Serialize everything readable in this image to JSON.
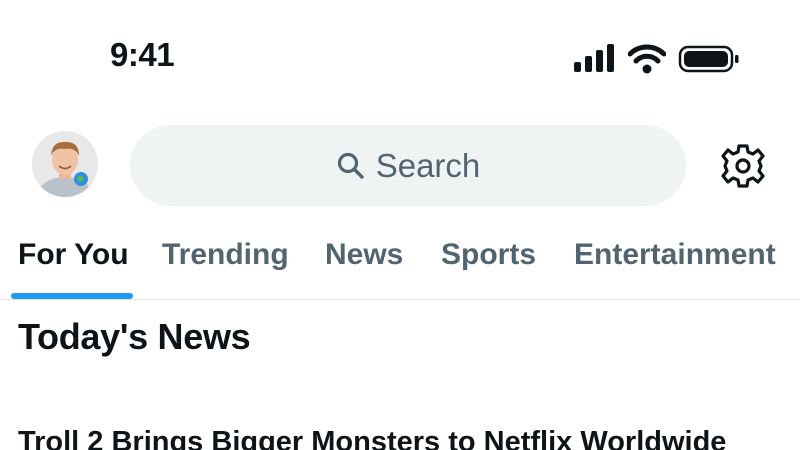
{
  "status_bar": {
    "time": "9:41"
  },
  "header": {
    "search": {
      "placeholder": "Search"
    }
  },
  "tabs": [
    {
      "label": "For You",
      "active": true
    },
    {
      "label": "Trending",
      "active": false
    },
    {
      "label": "News",
      "active": false
    },
    {
      "label": "Sports",
      "active": false
    },
    {
      "label": "Entertainment",
      "active": false
    }
  ],
  "content": {
    "section_title": "Today's News",
    "headline": "Troll 2 Brings Bigger Monsters to Netflix Worldwide"
  },
  "colors": {
    "accent": "#1d9bf0",
    "text_primary": "#0f1419",
    "text_secondary": "#536471",
    "search_bg": "#eff3f4"
  },
  "icons": [
    "cellular-signal-icon",
    "wifi-icon",
    "battery-icon",
    "search-icon",
    "gear-icon",
    "avatar"
  ]
}
